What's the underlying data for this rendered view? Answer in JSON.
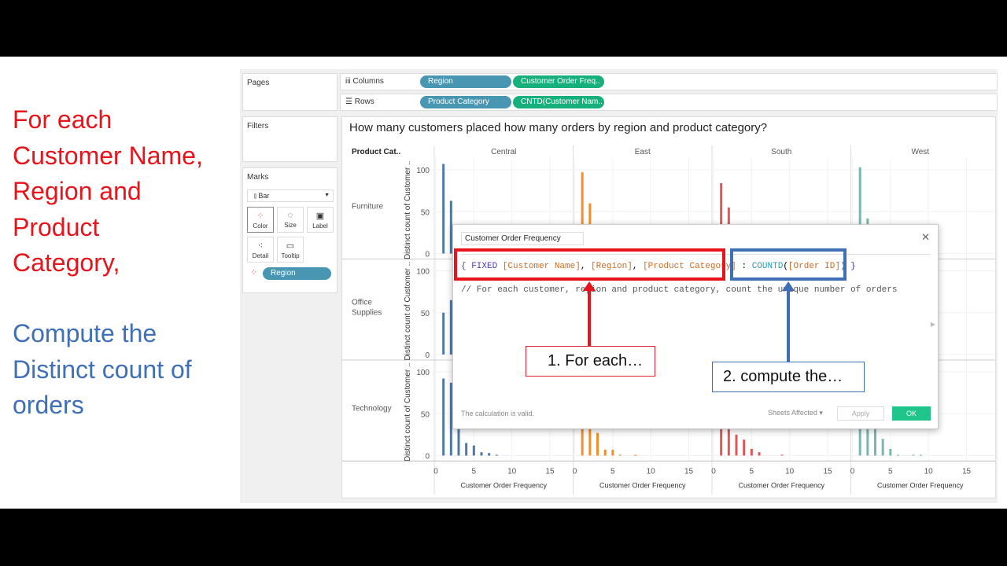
{
  "slide": {
    "left_text_red": [
      "For each",
      "Customer Name,",
      "Region and",
      "Product",
      "Category,"
    ],
    "left_text_blue": [
      "Compute the",
      "Distinct count of",
      "orders"
    ]
  },
  "tableau": {
    "pages_label": "Pages",
    "filters_label": "Filters",
    "marks_label": "Marks",
    "mark_type": "Bar",
    "mark_cards": [
      {
        "label": "Color",
        "icon": "color-dots-icon"
      },
      {
        "label": "Size",
        "icon": "size-icon"
      },
      {
        "label": "Label",
        "icon": "label-icon"
      },
      {
        "label": "Detail",
        "icon": "detail-icon"
      },
      {
        "label": "Tooltip",
        "icon": "tooltip-icon"
      }
    ],
    "color_pill": "Region",
    "columns_label": "Columns",
    "rows_label": "Rows",
    "columns_pills": [
      "Region",
      "Customer Order Freq.."
    ],
    "rows_pills": [
      "Product Category",
      "CNTD(Customer Nam.."
    ]
  },
  "chart_data": {
    "type": "bar",
    "title": "How many customers placed how many orders by region and product category?",
    "row_header": "Product Cat..",
    "columns": [
      "Central",
      "East",
      "South",
      "West"
    ],
    "rows": [
      "Furniture",
      "Office Supplies",
      "Technology"
    ],
    "xlabel": "Customer Order Frequency",
    "ylabel": "Distinct count of Customer ..",
    "xticks": [
      0,
      5,
      10,
      15
    ],
    "xlim": [
      0,
      17
    ],
    "yticks": [
      0,
      50,
      100
    ],
    "ylim": [
      0,
      110
    ],
    "colors": {
      "Central": "#4e79a7",
      "East": "#f28e2b",
      "South": "#e15759",
      "West": "#76b7b2"
    },
    "grid": true,
    "panels": [
      {
        "row": "Furniture",
        "col": "Central",
        "x": [
          1,
          2
        ],
        "y": [
          107,
          63
        ]
      },
      {
        "row": "Furniture",
        "col": "East",
        "x": [
          1,
          2
        ],
        "y": [
          97,
          60
        ]
      },
      {
        "row": "Furniture",
        "col": "South",
        "x": [
          1,
          2
        ],
        "y": [
          84,
          55
        ]
      },
      {
        "row": "Furniture",
        "col": "West",
        "x": [
          1,
          2
        ],
        "y": [
          103,
          42
        ]
      },
      {
        "row": "Office Supplies",
        "col": "Central",
        "x": [
          1,
          2
        ],
        "y": [
          50,
          65
        ]
      },
      {
        "row": "Technology",
        "col": "Central",
        "x": [
          1,
          2,
          3,
          4,
          5,
          6,
          7,
          8
        ],
        "y": [
          92,
          87,
          50,
          15,
          12,
          4,
          3,
          1
        ]
      },
      {
        "row": "Technology",
        "col": "East",
        "x": [
          1,
          2,
          3,
          4,
          5,
          6,
          8
        ],
        "y": [
          40,
          40,
          27,
          7,
          7,
          1,
          1
        ]
      },
      {
        "row": "Technology",
        "col": "South",
        "x": [
          1,
          2,
          3,
          4,
          5,
          6,
          9
        ],
        "y": [
          40,
          40,
          25,
          19,
          8,
          4,
          1
        ]
      },
      {
        "row": "Technology",
        "col": "West",
        "x": [
          1,
          2,
          3,
          4,
          5,
          6,
          8,
          9
        ],
        "y": [
          40,
          40,
          40,
          20,
          8,
          1,
          1,
          1
        ]
      }
    ]
  },
  "dialog": {
    "name_value": "Customer Order Frequency",
    "code": {
      "open": "{ ",
      "fixed": "FIXED ",
      "f1": "[Customer Name]",
      "c1": ", ",
      "f2": "[Region]",
      "c2": ", ",
      "f3": "[Product Category]",
      "colon": " : ",
      "fn": "COUNTD",
      "p1": "(",
      "f4": "[Order ID]",
      "p2": ") }"
    },
    "comment": "// For each customer, region and product category, count the unique number of orders",
    "status": "The calculation is valid.",
    "sheets_affected": "Sheets Affected ▾",
    "apply": "Apply",
    "ok": "OK",
    "close": "✕"
  },
  "callouts": {
    "one": "1. For each…",
    "two": "2. compute the…"
  }
}
